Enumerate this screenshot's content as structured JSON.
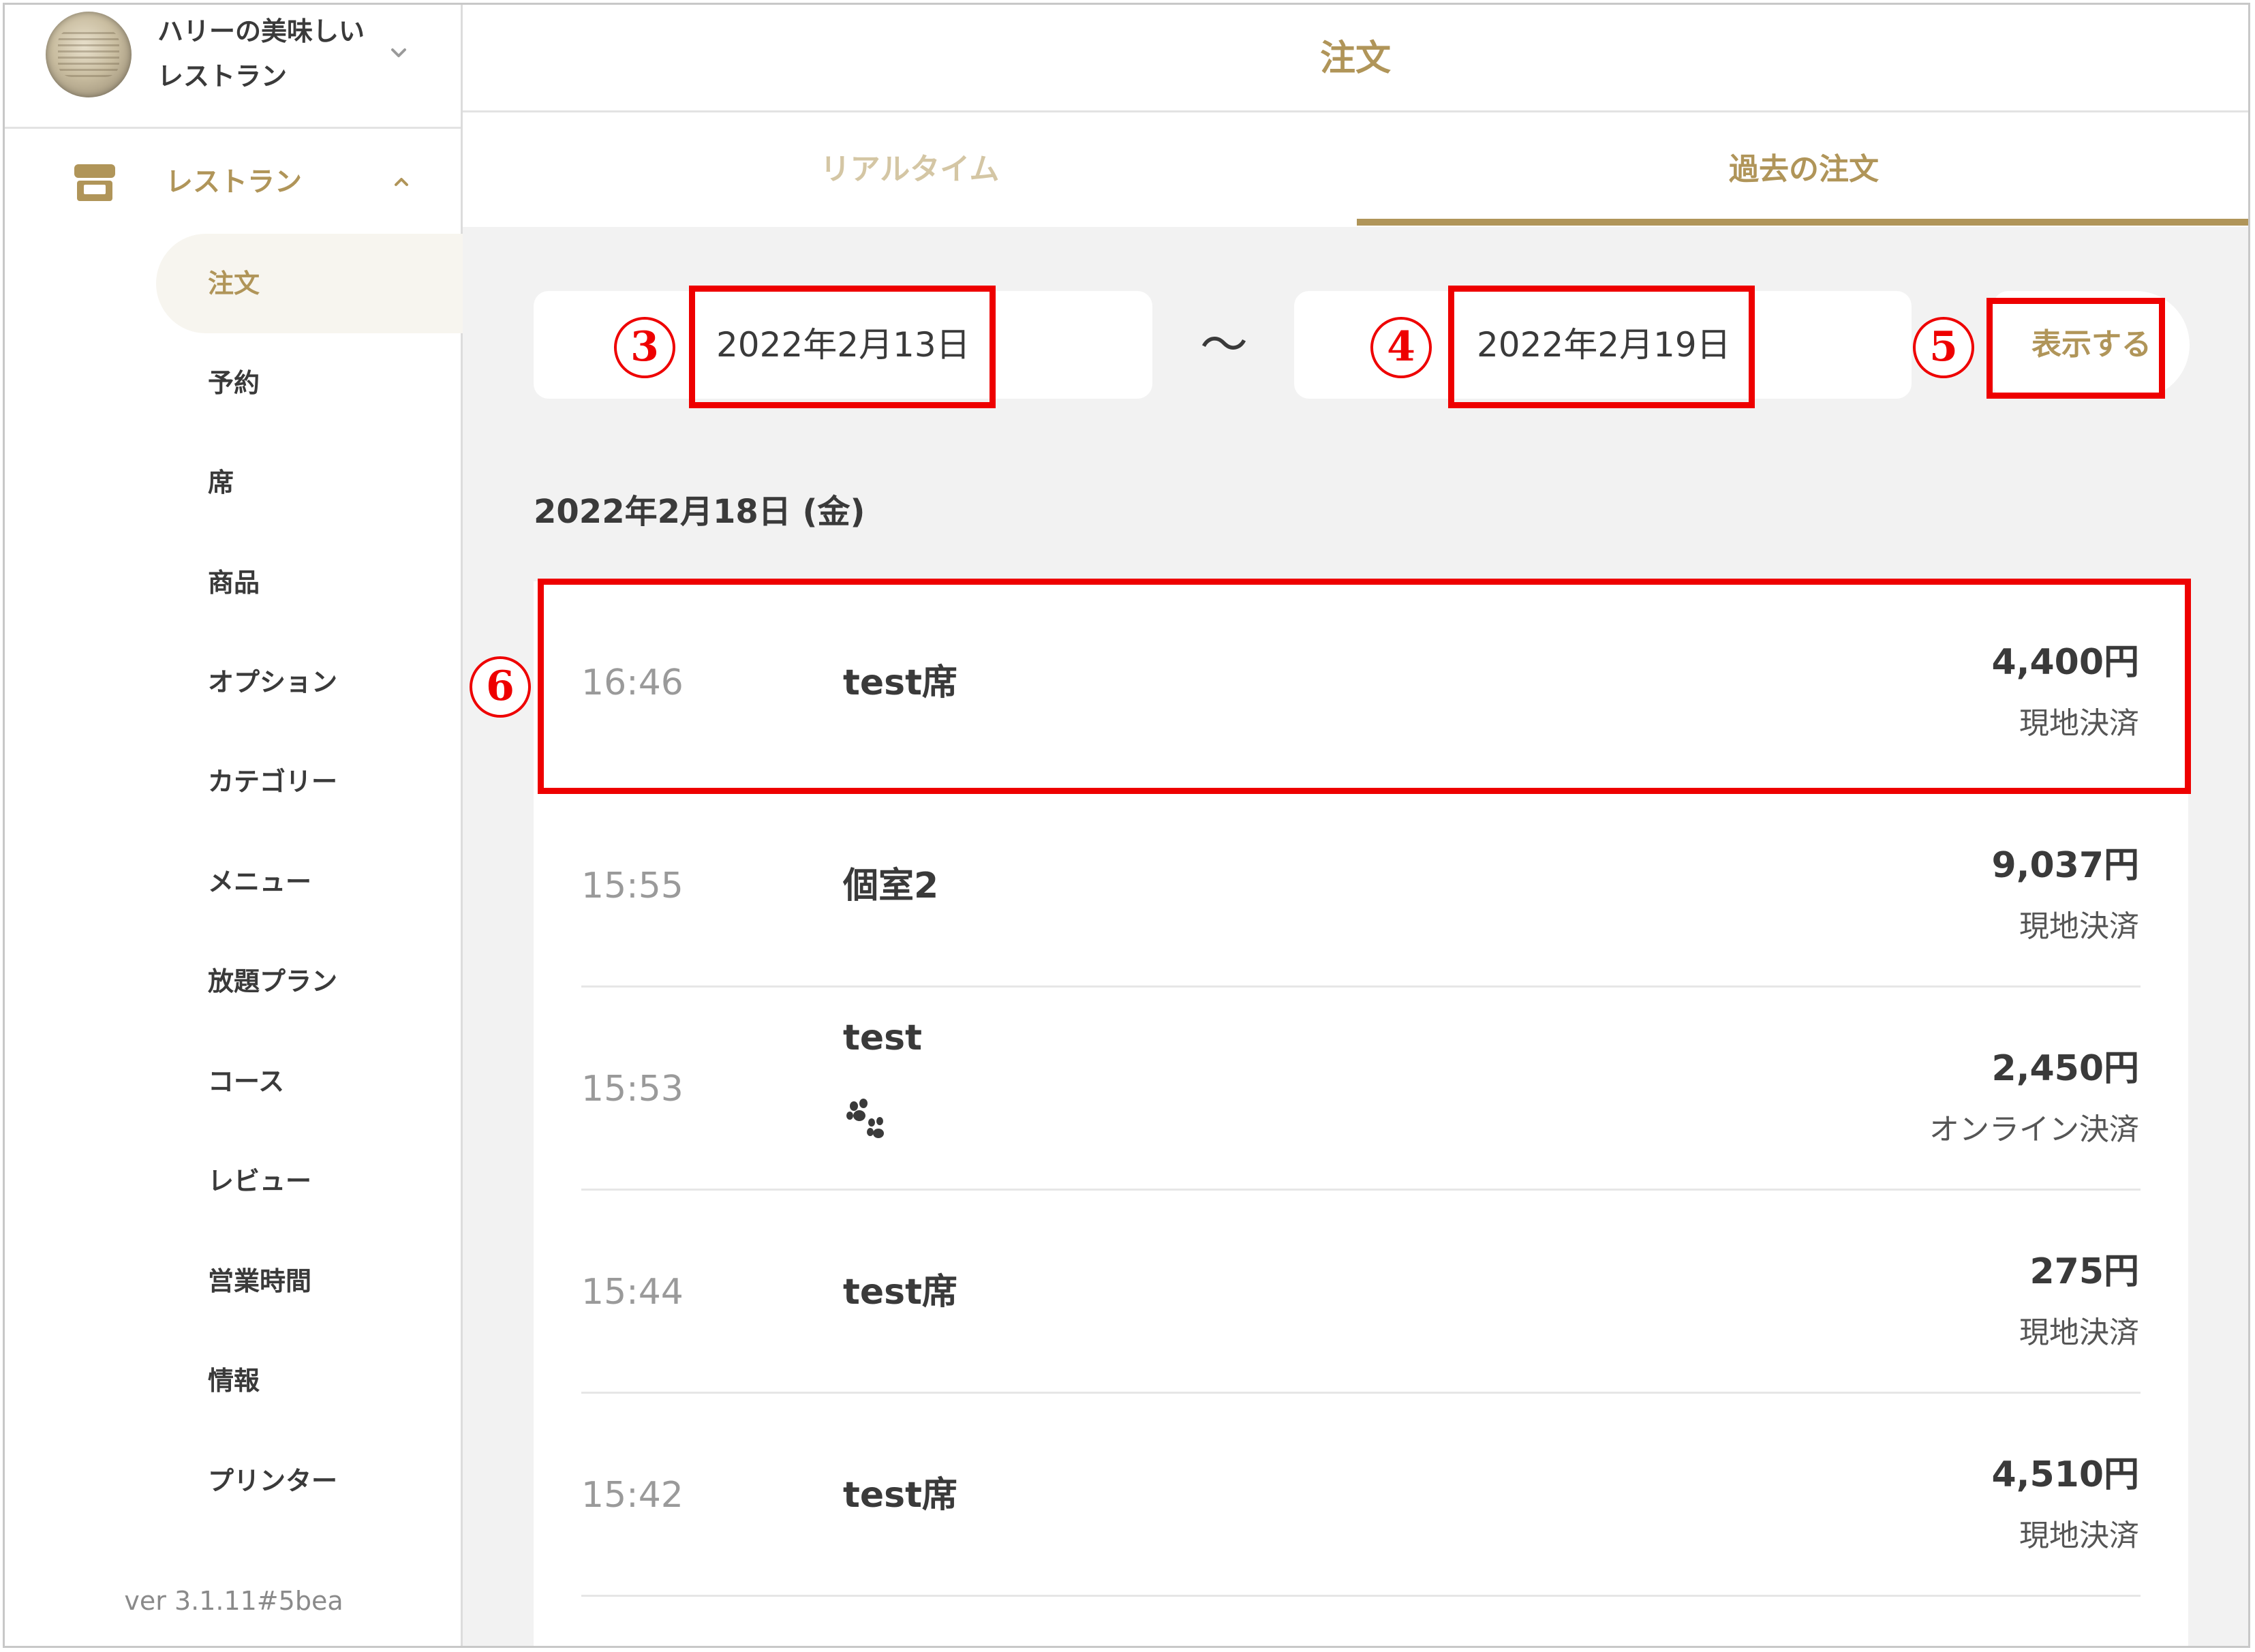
{
  "sidebar": {
    "restaurant_name": "ハリーの美味しいレストラン",
    "section_label": "レストラン",
    "items": [
      {
        "label": "注文"
      },
      {
        "label": "予約"
      },
      {
        "label": "席"
      },
      {
        "label": "商品"
      },
      {
        "label": "オプション"
      },
      {
        "label": "カテゴリー"
      },
      {
        "label": "メニュー"
      },
      {
        "label": "放題プラン"
      },
      {
        "label": "コース"
      },
      {
        "label": "レビュー"
      },
      {
        "label": "営業時間"
      },
      {
        "label": "情報"
      },
      {
        "label": "プリンター"
      }
    ],
    "version": "ver 3.1.11#5bea"
  },
  "header": {
    "title": "注文"
  },
  "tabs": [
    {
      "label": "リアルタイム"
    },
    {
      "label": "過去の注文"
    }
  ],
  "filter": {
    "from": "2022年2月13日",
    "separator": "～",
    "to": "2022年2月19日",
    "show_button": "表示する"
  },
  "day_heading": "2022年2月18日 (金)",
  "orders": [
    {
      "time": "16:46",
      "seat": "test席",
      "amount": "4,400円",
      "payment": "現地決済"
    },
    {
      "time": "15:55",
      "seat": "個室2",
      "amount": "9,037円",
      "payment": "現地決済"
    },
    {
      "time": "15:53",
      "seat": "test",
      "amount": "2,450円",
      "payment": "オンライン決済"
    },
    {
      "time": "15:44",
      "seat": "test席",
      "amount": "275円",
      "payment": "現地決済"
    },
    {
      "time": "15:42",
      "seat": "test席",
      "amount": "4,510円",
      "payment": "現地決済"
    }
  ],
  "annotations": [
    "3",
    "4",
    "5",
    "6"
  ],
  "colors": {
    "accent": "#b09559",
    "annotation": "#ee0000",
    "background": "#f2f2f2"
  }
}
